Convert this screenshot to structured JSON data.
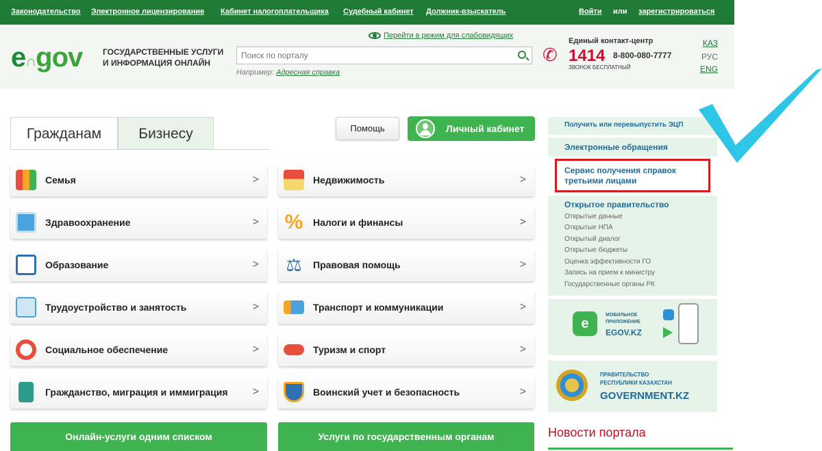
{
  "topnav": {
    "links": [
      "Законодательство",
      "Электронное лицензирование",
      "Кабинет налогоплательщика",
      "Судебный кабинет",
      "Должник-взыскатель"
    ],
    "login": "Войти",
    "or": "или",
    "register": "зарегистрироваться"
  },
  "header": {
    "logo_e": "e",
    "logo_gov": "gov",
    "tagline_1": "ГОСУДАРСТВЕННЫЕ УСЛУГИ",
    "tagline_2": "И ИНФОРМАЦИЯ ОНЛАЙН",
    "low_vision": "Перейти в режим для слабовидящих",
    "search_placeholder": "Поиск по порталу",
    "example_prefix": "Например:",
    "example_link": "Адресная справка",
    "contact_title": "Единый контакт-центр",
    "contact_short": "1414",
    "contact_phone": "8-800-080-7777",
    "contact_free": "ЗВОНОК БЕСПЛАТНЫЙ",
    "languages": [
      "КАЗ",
      "РУС",
      "ENG"
    ]
  },
  "tabs": [
    "Гражданам",
    "Бизнесу"
  ],
  "buttons": {
    "help": "Помощь",
    "cabinet": "Личный кабинет",
    "online_list": "Онлайн-услуги одним списком",
    "by_agency": "Услуги по государственным органам"
  },
  "categories_left": [
    "Семья",
    "Здравоохранение",
    "Образование",
    "Трудоустройство и занятость",
    "Социальное обеспечение",
    "Гражданство, миграция и иммиграция"
  ],
  "categories_right": [
    "Недвижимость",
    "Налоги и финансы",
    "Правовая помощь",
    "Транспорт и коммуникации",
    "Туризм и спорт",
    "Воинский учет и безопасность"
  ],
  "chevron": ">",
  "sidebar": {
    "ecp": "Получить или перевыпустить ЭЦП",
    "e_appeals": "Электронные обращения",
    "third_party_1": "Сервис получения справок",
    "third_party_2": "третьими лицами",
    "open_gov_title": "Открытое правительство",
    "open_gov_items": [
      "Открытые данные",
      "Открытые НПА",
      "Открытый диалог",
      "Открытые бюджеты",
      "Оценка эффективности ГО",
      "Запись на прием к министру",
      "Государственные органы РК"
    ],
    "app_line1": "МОБИЛЬНОЕ",
    "app_line2": "ПРИЛОЖЕНИЕ",
    "app_name": "EGOV.KZ",
    "gov_line1": "ПРАВИТЕЛЬСТВО",
    "gov_line2": "РЕСПУБЛИКИ КАЗАХСТАН",
    "gov_name": "GOVERNMENT.KZ",
    "news": "Новости портала"
  },
  "colors": {
    "brand_green": "#1f7a34",
    "button_green": "#3fb34f",
    "link_blue": "#1f6b9a",
    "highlight_red": "#d7191c",
    "check_cyan": "#2ec5e6"
  }
}
